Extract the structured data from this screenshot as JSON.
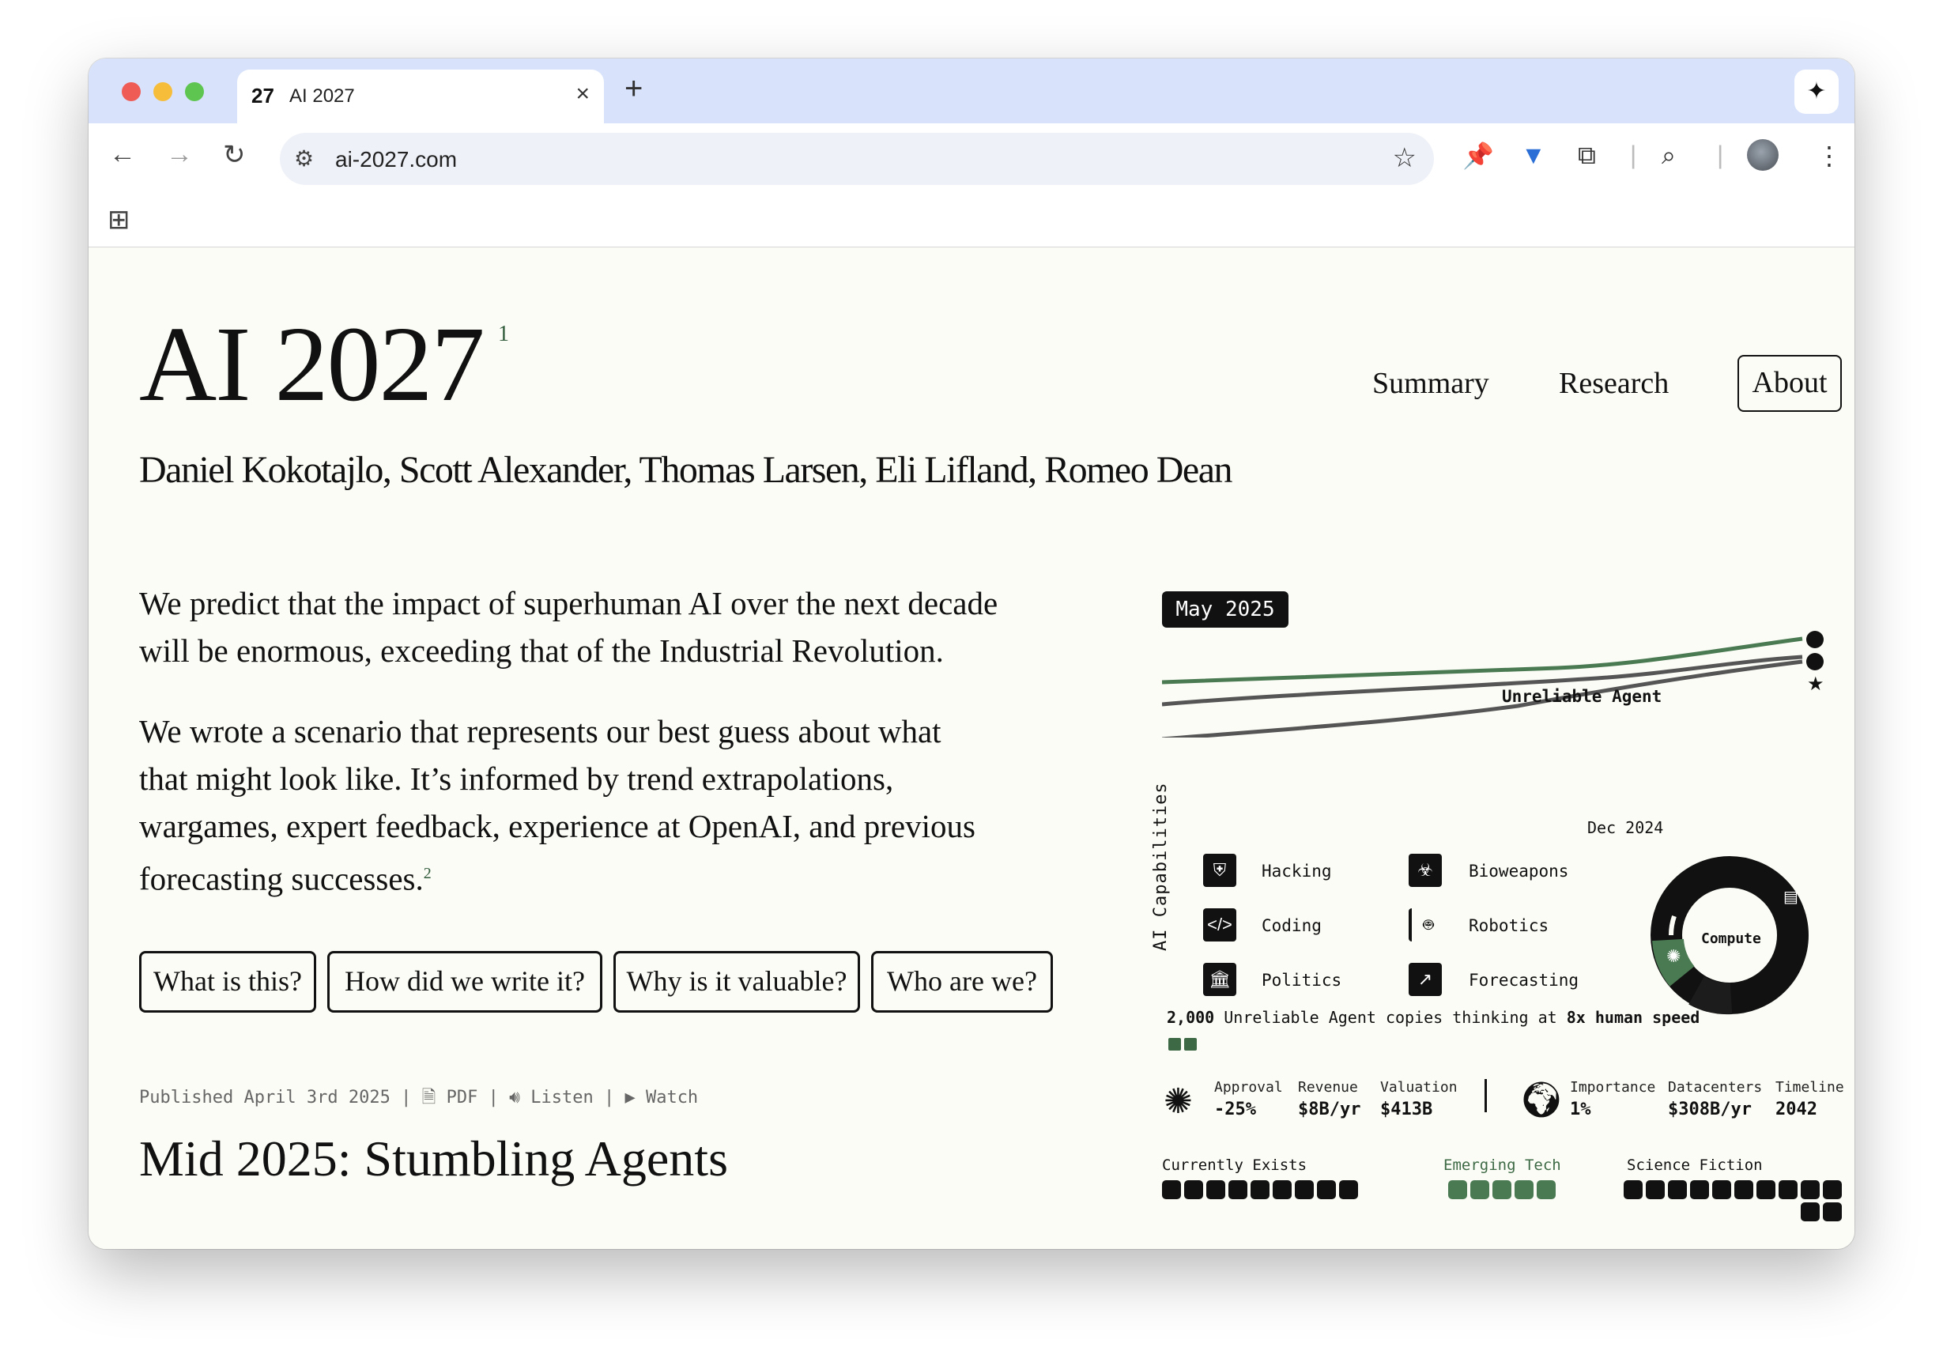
{
  "browser": {
    "tab_favicon_text": "27",
    "tab_title": "AI 2027",
    "tab_close": "×",
    "new_tab": "+",
    "url": "ai-2027.com",
    "icons": [
      "back-icon",
      "forward-icon",
      "reload-icon",
      "site-settings-icon",
      "bookmark-star-icon",
      "pin-icon",
      "extension-v-icon",
      "extensions-icon",
      "tab-search-icon",
      "profile-avatar",
      "menu-icon",
      "apps-grid-icon",
      "gemini-icon"
    ]
  },
  "site": {
    "title": "AI 2027",
    "title_sup": "1",
    "nav": [
      "Summary",
      "Research",
      "About"
    ],
    "authors": "Daniel Kokotajlo, Scott Alexander, Thomas Larsen, Eli Lifland, Romeo Dean",
    "intro_p1_l1": "We predict that the impact of superhuman AI over the next decade",
    "intro_p1_l2": "will be enormous, exceeding that of the Industrial Revolution.",
    "intro_p2_l1": "We wrote a scenario that represents our best guess about what",
    "intro_p2_l2": "that might look like. It’s informed by trend extrapolations,",
    "intro_p2_l3": "wargames, expert feedback, experience at OpenAI, and previous",
    "intro_p2_l4": "forecasting successes.",
    "intro_p2_sup": "2",
    "buttons": [
      "What is this?",
      "How did we write it?",
      "Why is it valuable?",
      "Who are we?"
    ],
    "published": "Published April 3rd 2025",
    "sep": "|",
    "pdf": "PDF",
    "listen": "Listen",
    "watch": "Watch",
    "section_title": "Mid 2025: Stumbling Agents"
  },
  "dashboard": {
    "date": "May 2025",
    "line_label": "Unreliable Agent",
    "axis_date": "Dec 2024",
    "capabilities_label": "AI Capabilities",
    "capabilities": [
      "Hacking",
      "Coding",
      "Politics",
      "Bioweapons",
      "Robotics",
      "Forecasting"
    ],
    "donut_label": "Compute",
    "copies_count": "2,000",
    "copies_mid": "Unreliable Agent copies thinking at",
    "copies_speed": "8x human speed",
    "metrics_left": [
      {
        "k": "Approval",
        "v": "-25%"
      },
      {
        "k": "Revenue",
        "v": "$8B/yr"
      },
      {
        "k": "Valuation",
        "v": "$413B"
      }
    ],
    "metrics_right": [
      {
        "k": "Importance",
        "v": "1%"
      },
      {
        "k": "Datacenters",
        "v": "$308B/yr"
      },
      {
        "k": "Timeline",
        "v": "2042"
      }
    ],
    "legend_exists": "Currently Exists",
    "legend_emerging": "Emerging Tech",
    "legend_scifi": "Science Fiction",
    "colors": {
      "green": "#4a7a52",
      "dark": "#111111",
      "line_gray": "#555555"
    }
  }
}
